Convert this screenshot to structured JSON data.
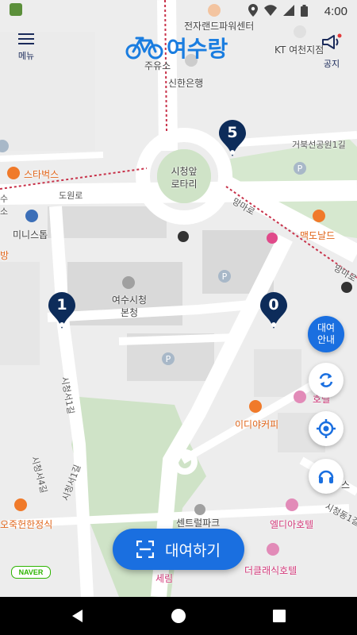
{
  "status_bar": {
    "time": "4:00",
    "icons": [
      "photo-icon",
      "location-icon",
      "wifi-icon",
      "signal-icon",
      "battery-icon"
    ]
  },
  "header": {
    "menu_label": "메뉴",
    "logo_text": "여수랑",
    "notice_label": "공지"
  },
  "map": {
    "labels": [
      {
        "text": "전자랜드파워센터",
        "style": "dark"
      },
      {
        "text": "주유소",
        "style": "dark"
      },
      {
        "text": "신한은행",
        "style": "dark"
      },
      {
        "text": "KT 여천지점",
        "style": "dark"
      },
      {
        "text": "거북선공원1길",
        "style": "normal"
      },
      {
        "text": "스타벅스",
        "style": "orange"
      },
      {
        "text": "도원로",
        "style": "normal"
      },
      {
        "text": "시청앞\n로타리",
        "style": "dark"
      },
      {
        "text": "망마로",
        "style": "normal"
      },
      {
        "text": "맥도날드",
        "style": "orange"
      },
      {
        "text": "미니스톱",
        "style": "dark"
      },
      {
        "text": "여수시청\n본청",
        "style": "dark"
      },
      {
        "text": "시청서1길",
        "style": "normal"
      },
      {
        "text": "이디야커피",
        "style": "orange"
      },
      {
        "text": "시청서4길",
        "style": "normal"
      },
      {
        "text": "시청서1길",
        "style": "normal"
      },
      {
        "text": "오죽헌한정식",
        "style": "orange"
      },
      {
        "text": "센트럴파크",
        "style": "dark"
      },
      {
        "text": "엘디아호텔",
        "style": "pink"
      },
      {
        "text": "더클래식호텔",
        "style": "pink"
      },
      {
        "text": "세림",
        "style": "pink"
      },
      {
        "text": "수",
        "style": "normal"
      },
      {
        "text": "방",
        "style": "orange"
      },
      {
        "text": "망마로",
        "style": "normal"
      },
      {
        "text": "시청동1길",
        "style": "normal"
      },
      {
        "text": "호텔",
        "style": "pink"
      },
      {
        "text": "스",
        "style": "dark"
      },
      {
        "text": "소",
        "style": "normal"
      }
    ]
  },
  "stations": [
    {
      "count": "5"
    },
    {
      "count": "1"
    },
    {
      "count": "0"
    }
  ],
  "controls": {
    "guide_label": "대여\n안내",
    "guide_line1": "대여",
    "guide_line2": "안내",
    "rent_label": "대여하기",
    "naver_label": "NAVER"
  },
  "colors": {
    "primary": "#1a6fe0",
    "marker": "#0d2c5a",
    "park": "#cfe3c7",
    "road": "#ffffff",
    "boundary": "#c8324a"
  }
}
